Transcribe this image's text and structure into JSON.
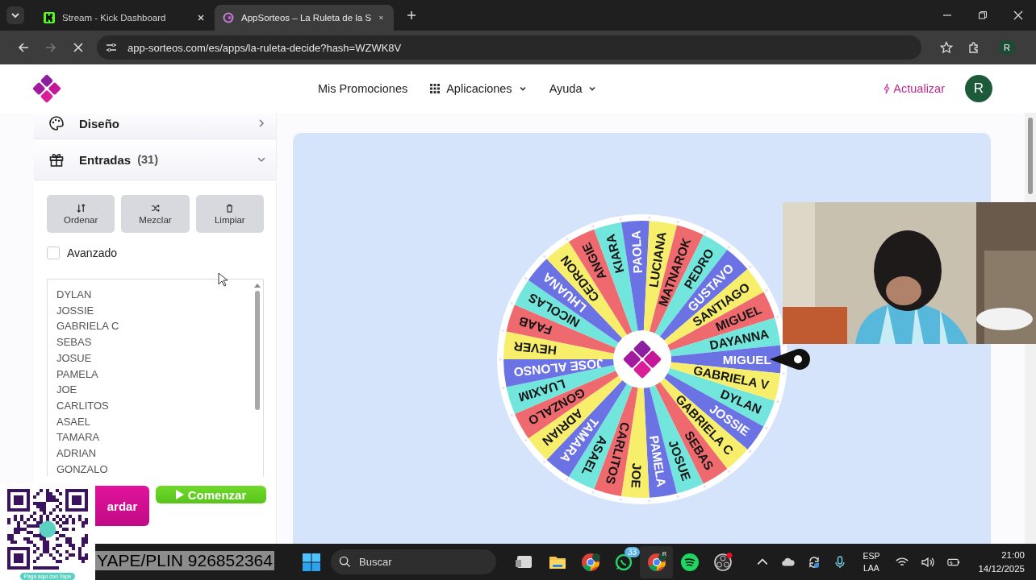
{
  "browser": {
    "tabs": [
      {
        "title": "Stream - Kick Dashboard",
        "kind": "kick",
        "selected": false
      },
      {
        "title": "AppSorteos – La Ruleta de la S",
        "kind": "appsorteos",
        "selected": true
      }
    ],
    "url": "app-sorteos.com/es/apps/la-ruleta-decide?hash=WZWK8V",
    "profile": "R"
  },
  "header": {
    "nav": [
      {
        "label": "Mis Promociones",
        "kind": "plain"
      },
      {
        "label": "Aplicaciones",
        "kind": "apps"
      },
      {
        "label": "Ayuda",
        "kind": "dropdown"
      }
    ],
    "upgrade": "Actualizar",
    "avatar": "R"
  },
  "sections": [
    {
      "title": "Diseño",
      "kind": "palette",
      "expanded": false
    },
    {
      "title": "Entradas",
      "count": "(31)",
      "kind": "gift",
      "expanded": true
    }
  ],
  "tools": [
    {
      "label": "Ordenar",
      "kind": "sort"
    },
    {
      "label": "Mezclar",
      "kind": "shuffle"
    },
    {
      "label": "Limpiar",
      "kind": "trash"
    }
  ],
  "advanced": {
    "label": "Avanzado",
    "checked": false
  },
  "entries": [
    "DYLAN",
    "JOSSIE",
    "GABRIELA C",
    "SEBAS",
    "JOSUE",
    "PAMELA",
    "JOE",
    "CARLITOS",
    "ASAEL",
    "TAMARA",
    "ADRIAN",
    "GONZALO"
  ],
  "actions": [
    {
      "label": "ardar",
      "kind": "save"
    },
    {
      "label": "Comenzar",
      "kind": "start"
    }
  ],
  "wheel": {
    "segments": [
      "DYLAN",
      "JOSSIE",
      "GABRIELA C",
      "SEBAS",
      "JOSUE",
      "PAMELA",
      "JOE",
      "CARLITOS",
      "ASAEL",
      "TAMARA",
      "ADRIAN",
      "GONZALO",
      "LUAXIM",
      "JOSE ALONSO",
      "HEVER",
      "FAAB",
      "NICOLAS",
      "LHUANA",
      "CEDRON",
      "ANGIE",
      "KIARA",
      "PAOLA",
      "LUCIANA",
      "MATNAROK",
      "PEDRO",
      "GUSTAVO",
      "SANTIAGO",
      "MIGUEL",
      "DAYANNA",
      "MIGUEL",
      "GABRIELA V"
    ]
  },
  "overlay": {
    "caption": "YAPE/PLIN 926852364",
    "qr_label": "Paga aquí con Yape"
  },
  "taskbar": {
    "search": "Buscar",
    "apps": [
      {
        "kind": "board"
      },
      {
        "kind": "folder"
      },
      {
        "kind": "chrome"
      },
      {
        "kind": "whatsapp",
        "badge": "33"
      },
      {
        "kind": "chrome-profile",
        "profile": "R"
      },
      {
        "kind": "spotify"
      },
      {
        "kind": "obs"
      }
    ],
    "language": "ESP",
    "layout": "LAA",
    "time": "21:00",
    "date": "14/12/2025"
  }
}
